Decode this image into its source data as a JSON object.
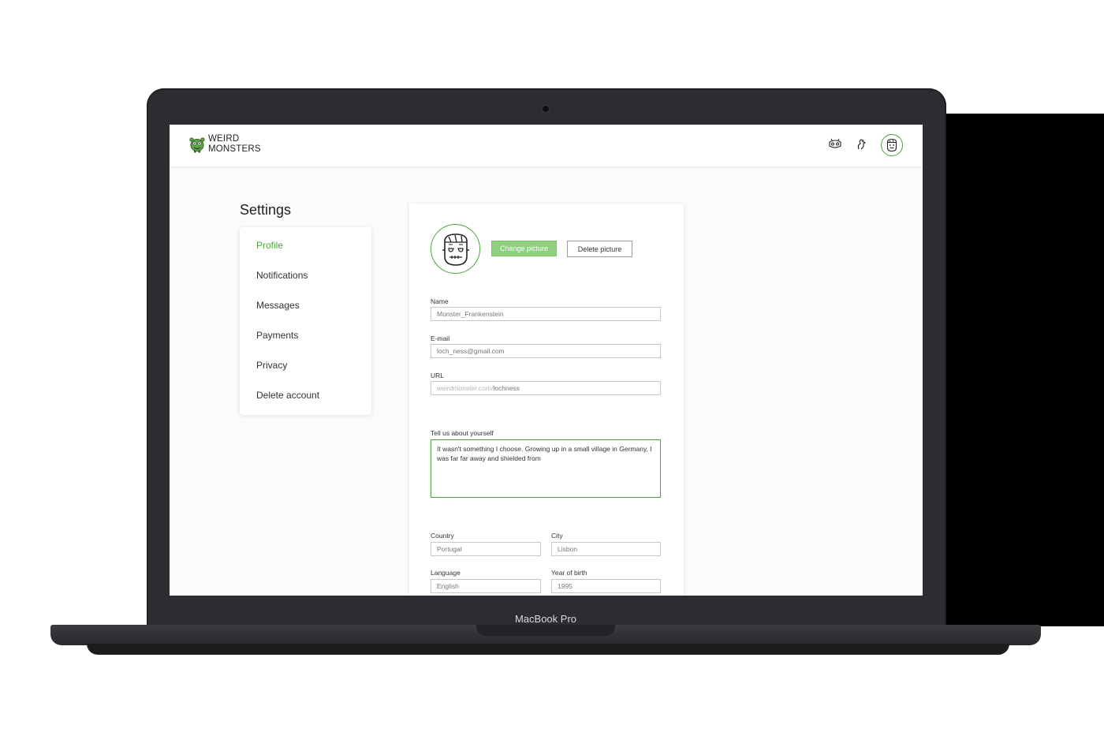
{
  "device": {
    "label": "MacBook Pro"
  },
  "header": {
    "logo_line1": "WEIRD",
    "logo_line2": "MONSTERS",
    "icons": [
      "monster-mask-icon",
      "dragon-icon",
      "frankenstein-avatar-icon"
    ]
  },
  "settings": {
    "title": "Settings",
    "menu": [
      {
        "label": "Profile",
        "active": true
      },
      {
        "label": "Notifications",
        "active": false
      },
      {
        "label": "Messages",
        "active": false
      },
      {
        "label": "Payments",
        "active": false
      },
      {
        "label": "Privacy",
        "active": false
      },
      {
        "label": "Delete account",
        "active": false
      }
    ]
  },
  "profile": {
    "change_picture": "Change picture",
    "delete_picture": "Delete picture",
    "name_label": "Name",
    "name_value": "Monster_Frankenstein",
    "email_label": "E-mail",
    "email_value": "loch_ness@gmail.com",
    "url_label": "URL",
    "url_prefix": "weirdmonster.com/",
    "url_value": "lochness",
    "about_label": "Tell us about yourself",
    "about_value": "It wasn't something I choose. Growing up in a small village in Germany, I was far far away and shielded from",
    "country_label": "Country",
    "country_value": "Portugal",
    "city_label": "City",
    "city_value": "Lisbon",
    "language_label": "Language",
    "language_value": "English",
    "year_label": "Year of birth",
    "year_value": "1995"
  },
  "colors": {
    "accent": "#47a836",
    "accent_light": "#8fd07f",
    "laptop": "#2c2d30"
  }
}
